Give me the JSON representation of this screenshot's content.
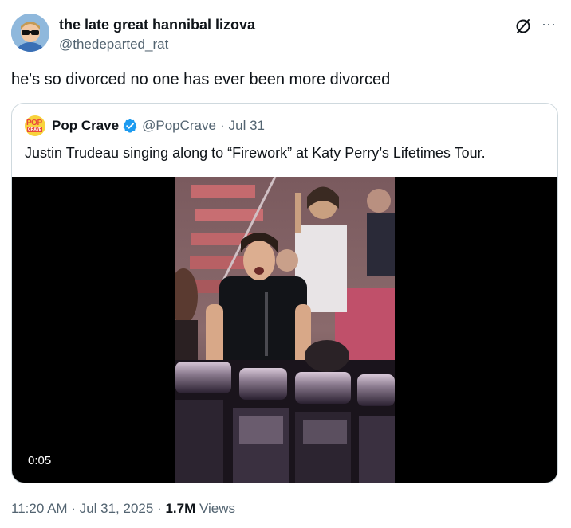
{
  "author": {
    "display_name": "the late great hannibal lizova",
    "handle": "@thedeparted_rat",
    "avatar_icon": "cartoon-avatar-with-sunglasses"
  },
  "tweet": {
    "text": "he's so divorced no one has ever been more divorced"
  },
  "actions": {
    "grok_icon": "grok-slash-icon",
    "more_icon": "more-dots-icon",
    "more_glyph": "···"
  },
  "quoted": {
    "avatar_top": "POP",
    "avatar_bottom": "CRAVE",
    "name": "Pop Crave",
    "handle": "@PopCrave",
    "separator": "·",
    "date": "Jul 31",
    "text": "Justin Trudeau singing along to “Firework” at Katy Perry’s Lifetimes Tour.",
    "video_time": "0:05",
    "verified_color": "#1d9bf0"
  },
  "meta": {
    "time": "11:20 AM",
    "sep1": " · ",
    "date": "Jul 31, 2025",
    "sep2": " · ",
    "views_count": "1.7M",
    "views_label": " Views"
  }
}
